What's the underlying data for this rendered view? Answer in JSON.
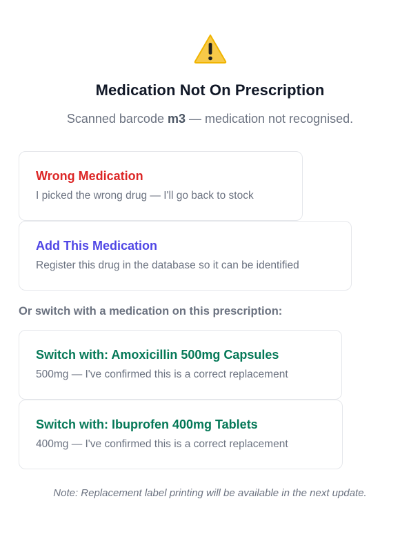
{
  "header": {
    "icon": "warning-icon",
    "title": "Medication Not On Prescription",
    "subtitle_prefix": "Scanned barcode ",
    "barcode": "m3",
    "subtitle_suffix": " — medication not recognised."
  },
  "options": {
    "wrong_medication": {
      "title": "Wrong Medication",
      "description": "I picked the wrong drug — I'll go back to stock"
    },
    "add_medication": {
      "title": "Add This Medication",
      "description": "Register this drug in the database so it can be identified"
    }
  },
  "switch_section": {
    "label": "Or switch with a medication on this prescription:",
    "items": [
      {
        "title": "Switch with: Amoxicillin 500mg Capsules",
        "description": "500mg — I've confirmed this is a correct replacement"
      },
      {
        "title": "Switch with: Ibuprofen 400mg Tablets",
        "description": "400mg — I've confirmed this is a correct replacement"
      }
    ]
  },
  "note": "Note: Replacement label printing will be available in the next update.",
  "colors": {
    "warning": "#f5c518",
    "danger": "#dc2626",
    "primary": "#4f46e5",
    "success": "#047857",
    "muted": "#6b7280"
  }
}
